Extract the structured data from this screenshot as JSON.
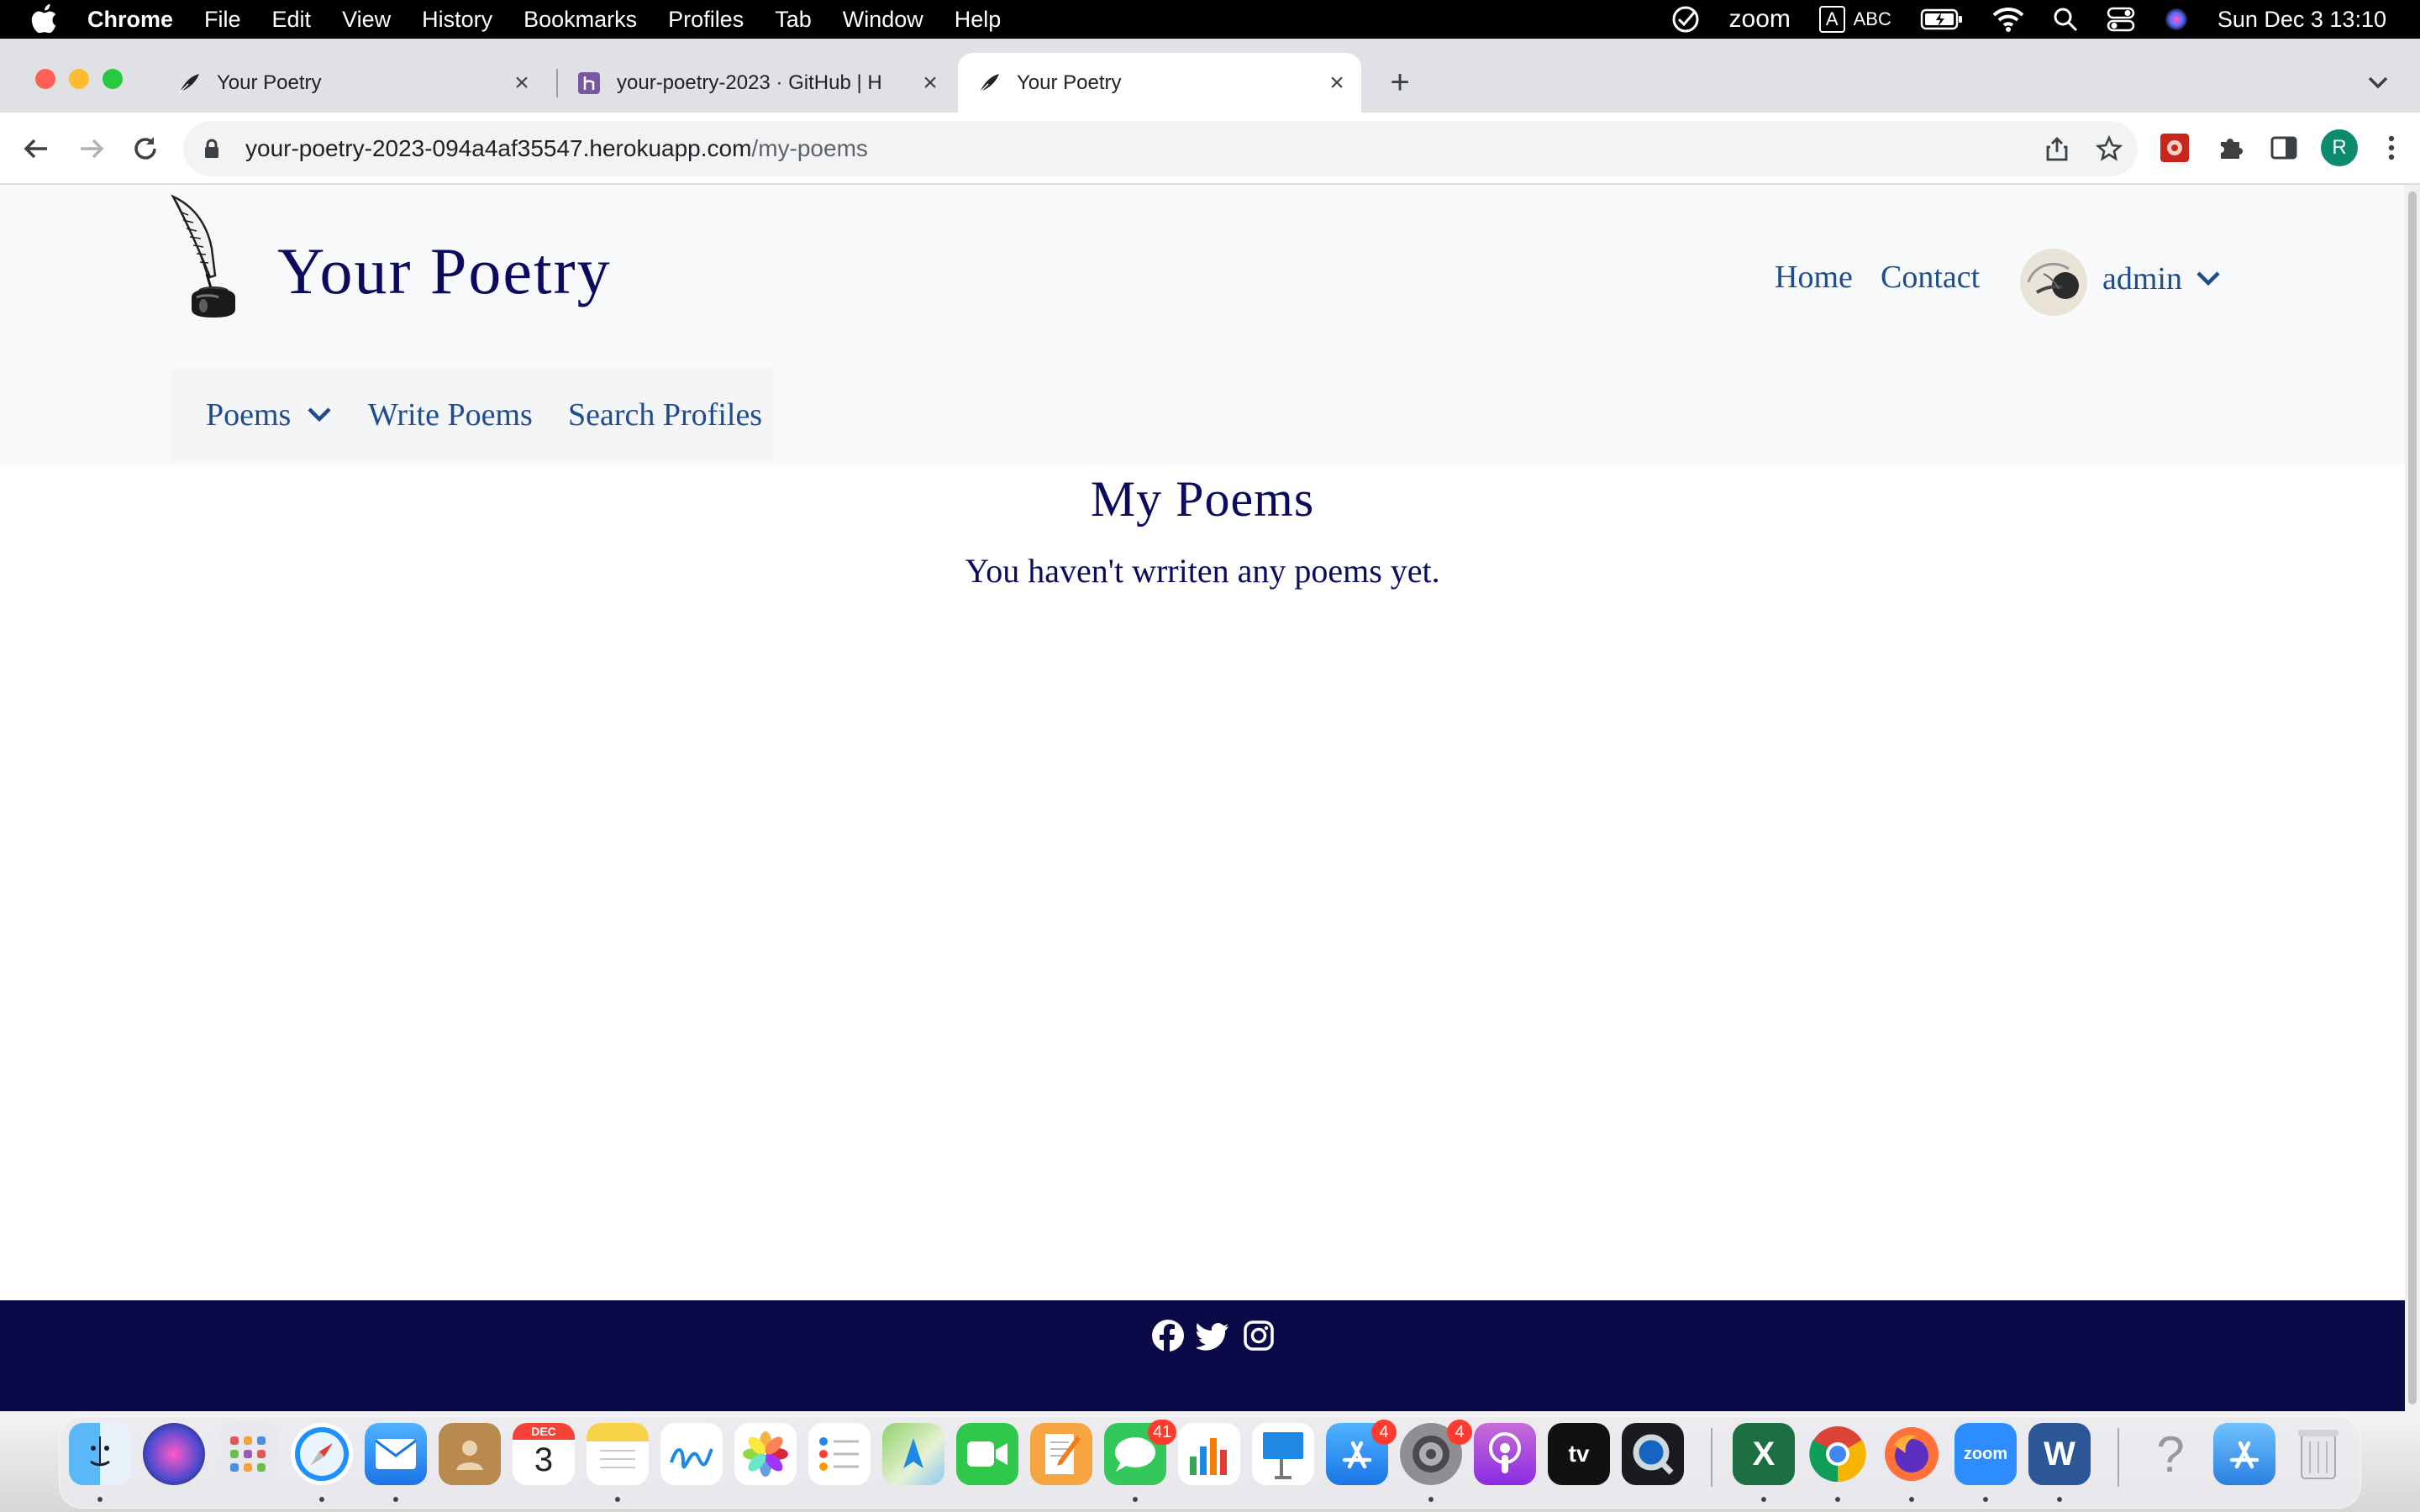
{
  "menubar": {
    "app": "Chrome",
    "items": [
      "File",
      "Edit",
      "View",
      "History",
      "Bookmarks",
      "Profiles",
      "Tab",
      "Window",
      "Help"
    ],
    "zoom_label": "zoom",
    "input_source_box": "A",
    "input_source": "ABC",
    "datetime": "Sun Dec 3  13:10"
  },
  "browser": {
    "tabs": [
      {
        "label": "Your Poetry",
        "favicon": "quill-icon"
      },
      {
        "label": "your-poetry-2023 · GitHub | H",
        "favicon": "heroku-icon"
      },
      {
        "label": "Your Poetry",
        "favicon": "quill-icon",
        "active": true
      }
    ],
    "new_tab_label": "+",
    "url_host": "your-poetry-2023-094a4af35547.herokuapp.com",
    "url_path": "/my-poems",
    "profile_initial": "R"
  },
  "site": {
    "brand": "Your Poetry",
    "nav": {
      "home": "Home",
      "contact": "Contact",
      "user": "admin"
    },
    "subnav": {
      "poems": "Poems",
      "write": "Write Poems",
      "search": "Search Profiles"
    },
    "page_title": "My Poems",
    "empty_message": "You haven't wrriten any poems yet.",
    "footer_social": [
      "facebook-icon",
      "twitter-icon",
      "instagram-icon"
    ],
    "colors": {
      "heading": "#0a0a5e",
      "link": "#1f4c8f",
      "footer": "#0a0a48",
      "header_bg": "#f8f9fa"
    }
  },
  "dock": {
    "calendar_month": "DEC",
    "calendar_day": "3",
    "messages_badge": "41",
    "appstore_badge": "4",
    "settings_badge": "4",
    "appletv_label": "tv",
    "zoom_label": "zoom",
    "excel_label": "X",
    "word_label": "W"
  }
}
